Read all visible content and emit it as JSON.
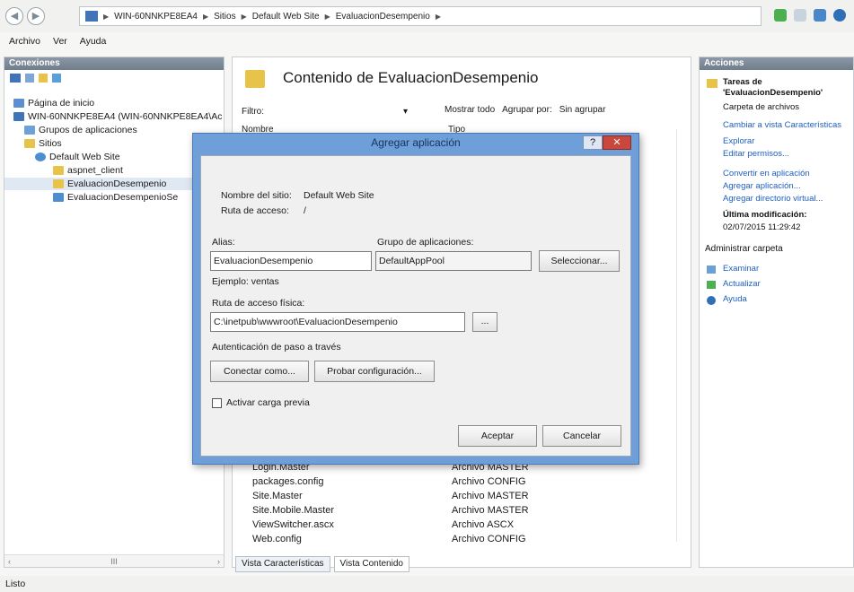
{
  "address": {
    "crumbs": [
      "WIN-60NNKPE8EA4",
      "Sitios",
      "Default Web Site",
      "EvaluacionDesempenio"
    ]
  },
  "menu": [
    "Archivo",
    "Ver",
    "Ayuda"
  ],
  "connections": {
    "title": "Conexiones",
    "tree": [
      {
        "label": "Página de inicio",
        "indent": 0
      },
      {
        "label": "WIN-60NNKPE8EA4 (WIN-60NNKPE8EA4\\Ac",
        "indent": 0
      },
      {
        "label": "Grupos de aplicaciones",
        "indent": 1
      },
      {
        "label": "Sitios",
        "indent": 1
      },
      {
        "label": "Default Web Site",
        "indent": 2
      },
      {
        "label": "aspnet_client",
        "indent": 3
      },
      {
        "label": "EvaluacionDesempenio",
        "indent": 3
      },
      {
        "label": "EvaluacionDesempenioSe",
        "indent": 3
      }
    ],
    "scroll_char": "III"
  },
  "content": {
    "title": "Contenido de EvaluacionDesempenio",
    "filter_label": "Filtro:",
    "show_all": "Mostrar todo",
    "group_by_label": "Agrupar por:",
    "group_by_value": "Sin agrupar",
    "col_name": "Nombre",
    "col_type": "Tipo",
    "rows": [
      {
        "name": "Login.Master",
        "type": "Archivo MASTER"
      },
      {
        "name": "packages.config",
        "type": "Archivo CONFIG"
      },
      {
        "name": "Site.Master",
        "type": "Archivo MASTER"
      },
      {
        "name": "Site.Mobile.Master",
        "type": "Archivo MASTER"
      },
      {
        "name": "ViewSwitcher.ascx",
        "type": "Archivo ASCX"
      },
      {
        "name": "Web.config",
        "type": "Archivo CONFIG"
      }
    ],
    "tab_features": "Vista Características",
    "tab_content": "Vista Contenido"
  },
  "actions": {
    "title": "Acciones",
    "task_title": "Tareas de 'EvaluacionDesempenio'",
    "task_sub": "Carpeta de archivos",
    "links": [
      "Cambiar a vista Características",
      "Explorar",
      "Editar permisos...",
      "Convertir en aplicación",
      "Agregar aplicación...",
      "Agregar directorio virtual..."
    ],
    "last_mod_label": "Última modificación:",
    "last_mod_value": "02/07/2015 11:29:42",
    "manage_folder": "Administrar carpeta",
    "links2": [
      "Examinar",
      "Actualizar",
      "Ayuda"
    ]
  },
  "dialog": {
    "title": "Agregar aplicación",
    "site_name_label": "Nombre del sitio:",
    "site_name_value": "Default Web Site",
    "path_label": "Ruta de acceso:",
    "path_value": "/",
    "alias_label": "Alias:",
    "alias_value": "EvaluacionDesempenio",
    "pool_label": "Grupo de aplicaciones:",
    "pool_value": "DefaultAppPool",
    "select_button": "Seleccionar...",
    "example": "Ejemplo: ventas",
    "physical_label": "Ruta de acceso física:",
    "physical_value": "C:\\inetpub\\wwwroot\\EvaluacionDesempenio",
    "browse_button": "...",
    "auth_label": "Autenticación de paso a través",
    "connect_button": "Conectar como...",
    "test_button": "Probar configuración...",
    "preload_label": "Activar carga previa",
    "ok_button": "Aceptar",
    "cancel_button": "Cancelar",
    "help_char": "?",
    "close_char": "✕"
  },
  "status": "Listo",
  "colors": {
    "accent": "#1f5fbf",
    "dialog_frame": "#6e9fd8",
    "close": "#c9473c",
    "folder": "#e8c34a"
  }
}
